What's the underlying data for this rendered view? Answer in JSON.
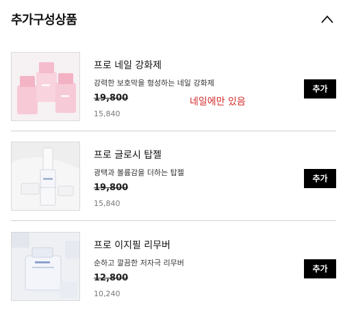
{
  "header": {
    "title": "추가구성상품"
  },
  "items": [
    {
      "name": "프로 네일 강화제",
      "desc": "강력한 보호막을 형성하는 네일 강화제",
      "orig_price": "19,800",
      "sale_price": "15,840",
      "add_label": "추가",
      "note": "네일에만 있음",
      "image_icon": "pink-polish-bottles"
    },
    {
      "name": "프로 글로시 탑젤",
      "desc": "광택과 볼륨감을 더하는 탑젤",
      "orig_price": "19,800",
      "sale_price": "15,840",
      "add_label": "추가",
      "image_icon": "clear-topgel-bottles"
    },
    {
      "name": "프로 이지필 리무버",
      "desc": "순하고 깔끔한 저자극 리무버",
      "orig_price": "12,800",
      "sale_price": "10,240",
      "add_label": "추가",
      "image_icon": "remover-bottle"
    }
  ],
  "colors": {
    "button_bg": "#000000",
    "note_red": "#d42b2b",
    "divider": "#cfcfcf"
  }
}
